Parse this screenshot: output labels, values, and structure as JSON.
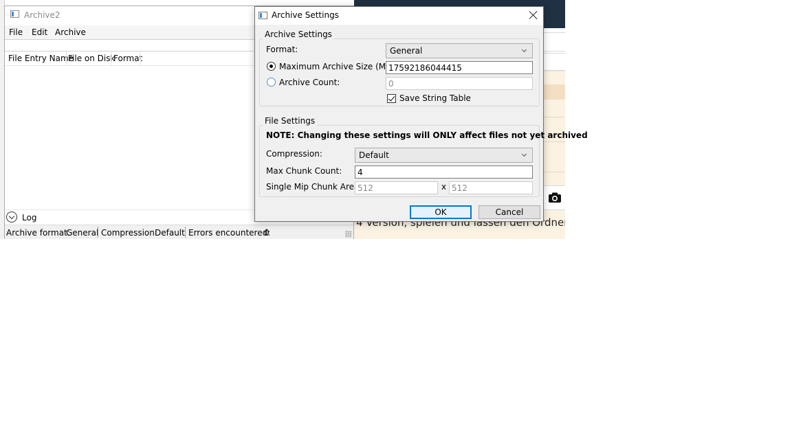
{
  "background": {
    "text_line": "4 Version, spielen und lassen den Ordner"
  },
  "main_window": {
    "title": "Archive2",
    "menu": [
      "File",
      "Edit",
      "Archive"
    ],
    "columns": [
      "File Entry Name",
      "File on Disk",
      "Format"
    ],
    "log_label": "Log",
    "status": {
      "archive_format_label": "Archive format:",
      "archive_format_value": "General",
      "compression_label": "Compression:",
      "compression_value": "Default",
      "errors_label": "Errors encountered:",
      "errors_value": "0"
    }
  },
  "dialog": {
    "title": "Archive Settings",
    "archive_settings": {
      "group_title": "Archive Settings",
      "format_label": "Format:",
      "format_value": "General",
      "max_size_label": "Maximum Archive Size (MB):",
      "max_size_value": "17592186044415",
      "max_size_selected": true,
      "count_label": "Archive Count:",
      "count_value": "0",
      "save_string_table_label": "Save String Table",
      "save_string_table_checked": true
    },
    "file_settings": {
      "group_title": "File Settings",
      "note": "NOTE: Changing these settings will ONLY affect files not yet archived",
      "compression_label": "Compression:",
      "compression_value": "Default",
      "max_chunk_label": "Max Chunk Count:",
      "max_chunk_value": "4",
      "mip_area_label": "Single Mip Chunk Area:",
      "mip_width": "512",
      "mip_separator": "x",
      "mip_height": "512"
    },
    "buttons": {
      "ok": "OK",
      "cancel": "Cancel"
    }
  }
}
